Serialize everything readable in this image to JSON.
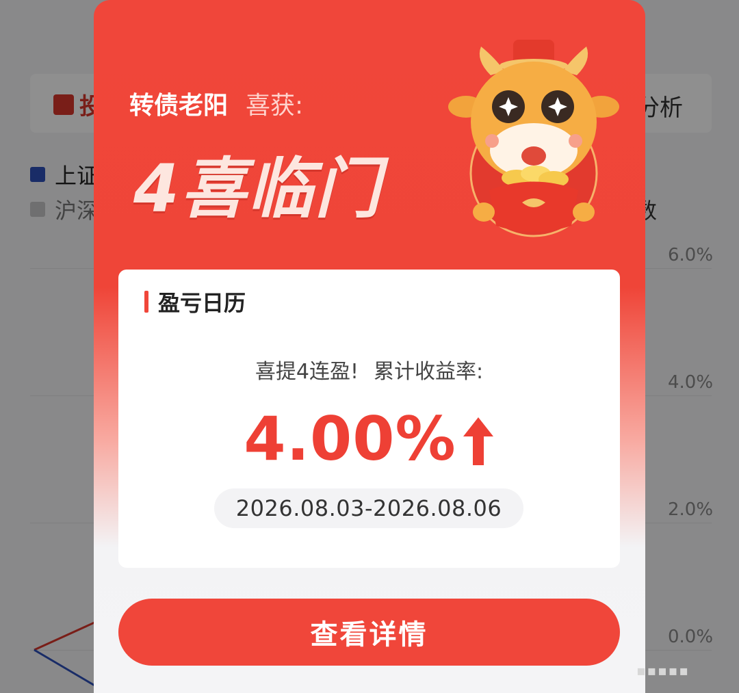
{
  "background": {
    "tab_left": "投",
    "tab_right": "分析",
    "legend": [
      {
        "label": "上证",
        "color": "#2d4fb8"
      },
      {
        "label": "沪深",
        "color": "#c6c6c8"
      }
    ],
    "legend_right": "数",
    "y_ticks": [
      "6.0%",
      "4.0%",
      "2.0%",
      "0.0%"
    ],
    "series_colors": {
      "red": "#d8362c",
      "blue": "#2d4fb8"
    }
  },
  "modal": {
    "username": "转债老阳",
    "award_label": "喜获:",
    "title": "4喜临门",
    "mascot_icon": "ox-mascot-icon",
    "calendar": {
      "title": "盈亏日历",
      "streak_text": "喜提4连盈!",
      "cumulative_label": "累计收益率:",
      "return_value": "4.00%",
      "trend_icon": "arrow-up-icon",
      "date_range": "2026.08.03-2026.08.06"
    },
    "detail_button": "查看详情"
  },
  "colors": {
    "accent": "#f0463a",
    "return_red": "#ee4035"
  }
}
